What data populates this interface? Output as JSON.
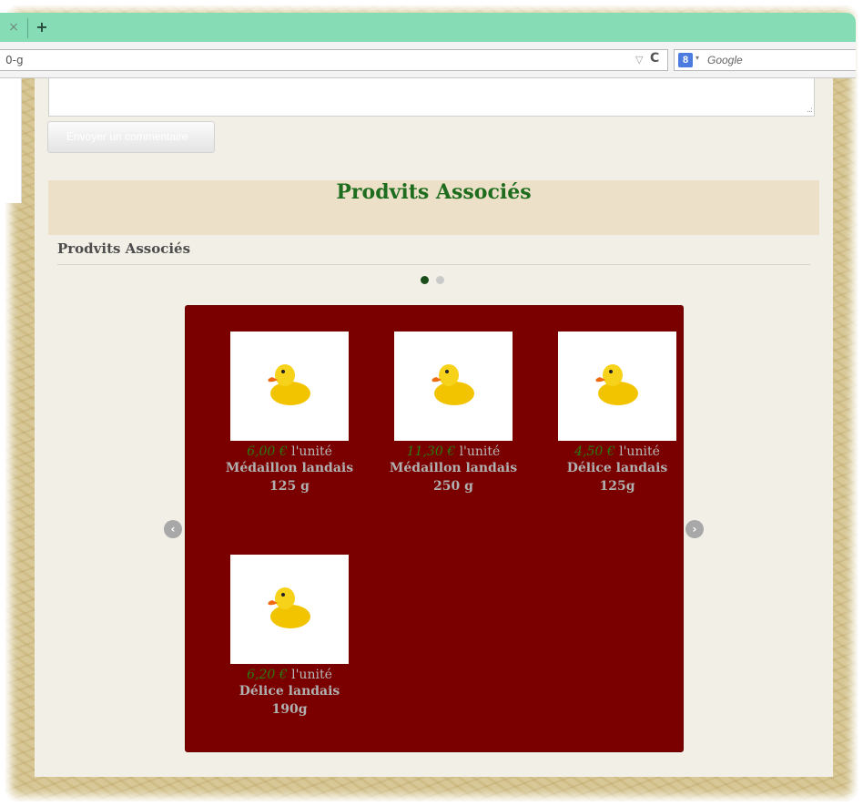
{
  "browser": {
    "close_tab": "×",
    "new_tab": "+",
    "url": "0-g",
    "url_dropdown": "▽",
    "reload": "C",
    "search_engine_badge": "8",
    "search_caret": "▾",
    "search_placeholder": "Google"
  },
  "comment": {
    "resize_grip": "..:",
    "send_button": "Envoyer un commentaire"
  },
  "related": {
    "banner_title": "Prodvits Associés",
    "subtitle": "Prodvits Associés",
    "pagination_active": 1,
    "pagination_total": 2,
    "prev_arrow": "‹",
    "next_arrow": "›",
    "products": [
      {
        "price": "6,00 €",
        "unit": "l'unité",
        "name_line1": "Médaillon landais",
        "name_line2": "125 g",
        "icon": "rubber-duck"
      },
      {
        "price": "11,30 €",
        "unit": "l'unité",
        "name_line1": "Médaillon landais",
        "name_line2": "250 g",
        "icon": "rubber-duck"
      },
      {
        "price": "4,50 €",
        "unit": "l'unité",
        "name_line1": "Délice landais",
        "name_line2": "125g",
        "icon": "rubber-duck"
      },
      {
        "price": "6,20 €",
        "unit": "l'unité",
        "name_line1": "Délice landais",
        "name_line2": "190g",
        "icon": "rubber-duck"
      }
    ]
  },
  "colors": {
    "tab_strip": "#86ddb5",
    "banner_bg": "#ede0c8",
    "banner_text": "#1e6d1e",
    "carousel_bg": "#7a0000",
    "price": "#2a7a10"
  }
}
